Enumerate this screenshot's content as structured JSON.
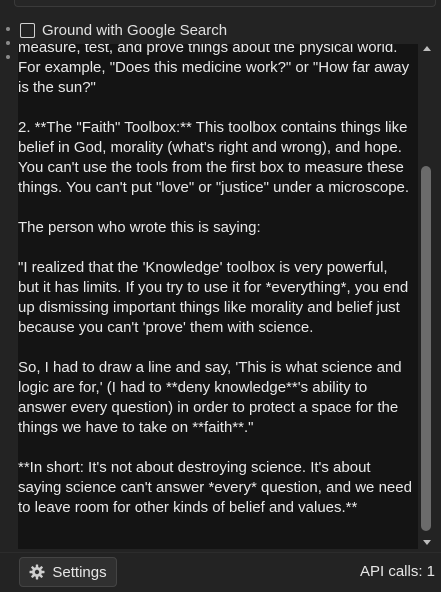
{
  "ground_search": {
    "label": "Ground with Google Search",
    "checked": false
  },
  "response": {
    "text": "measure, test, and prove things about the physical world. For example, \"Does this medicine work?\" or \"How far away is the sun?\"\n\n2. **The \"Faith\" Toolbox:** This toolbox contains things like belief in God, morality (what's right and wrong), and hope. You can't use the tools from the first box to measure these things. You can't put \"love\" or \"justice\" under a microscope.\n\nThe person who wrote this is saying:\n\n\"I realized that the 'Knowledge' toolbox is very powerful, but it has limits. If you try to use it for *everything*, you end up dismissing important things like morality and belief just because you can't 'prove' them with science.\n\nSo, I had to draw a line and say, 'This is what science and logic are for,' (I had to **deny knowledge**'s ability to answer every question) in order to protect a space for the things we have to take on **faith**.\"\n\n**In short: It's not about destroying science. It's about saying science can't answer *every* question, and we need to leave room for other kinds of belief and values.**"
  },
  "footer": {
    "settings_label": "Settings",
    "settings_icon": "gear-icon",
    "api_calls_label": "API calls: 1"
  }
}
